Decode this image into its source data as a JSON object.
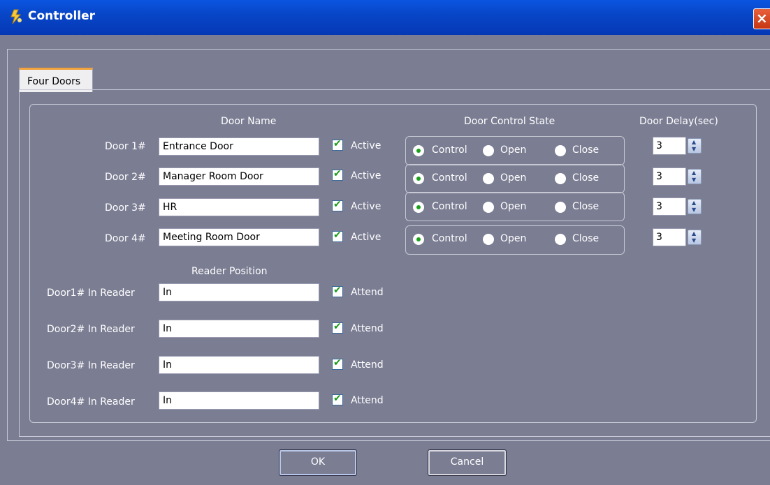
{
  "window": {
    "title": "Controller",
    "close_glyph": "×"
  },
  "tabs": [
    {
      "label": "Four Doors",
      "active": true
    }
  ],
  "headers": {
    "door_name": "Door Name",
    "door_control_state": "Door Control State",
    "door_delay": "Door Delay(sec)",
    "reader_position": "Reader Position"
  },
  "doors": [
    {
      "label": "Door 1#",
      "name": "Entrance Door",
      "active_label": "Active",
      "active": true,
      "state": "Control",
      "delay": "3"
    },
    {
      "label": "Door 2#",
      "name": "Manager Room Door",
      "active_label": "Active",
      "active": true,
      "state": "Control",
      "delay": "3"
    },
    {
      "label": "Door 3#",
      "name": "HR",
      "active_label": "Active",
      "active": true,
      "state": "Control",
      "delay": "3"
    },
    {
      "label": "Door 4#",
      "name": "Meeting Room Door",
      "active_label": "Active",
      "active": true,
      "state": "Control",
      "delay": "3"
    }
  ],
  "state_options": {
    "control": "Control",
    "open": "Open",
    "close": "Close"
  },
  "readers": [
    {
      "label": "Door1# In Reader",
      "position": "In",
      "attend_label": "Attend",
      "attend": true
    },
    {
      "label": "Door2# In Reader",
      "position": "In",
      "attend_label": "Attend",
      "attend": true
    },
    {
      "label": "Door3# In Reader",
      "position": "In",
      "attend_label": "Attend",
      "attend": true
    },
    {
      "label": "Door4# In Reader",
      "position": "In",
      "attend_label": "Attend",
      "attend": true
    }
  ],
  "buttons": {
    "ok": "OK",
    "cancel": "Cancel"
  },
  "colors": {
    "titlebar": "#0846c8",
    "background": "#7b7d93",
    "tab_accent": "#f2a23a",
    "check_green": "#1a9a1a",
    "close_red": "#c63712"
  },
  "icons": {
    "title": "controller-app-icon",
    "close": "close-icon",
    "check": "checkmark-icon",
    "spin": "spin-arrows-icon"
  }
}
